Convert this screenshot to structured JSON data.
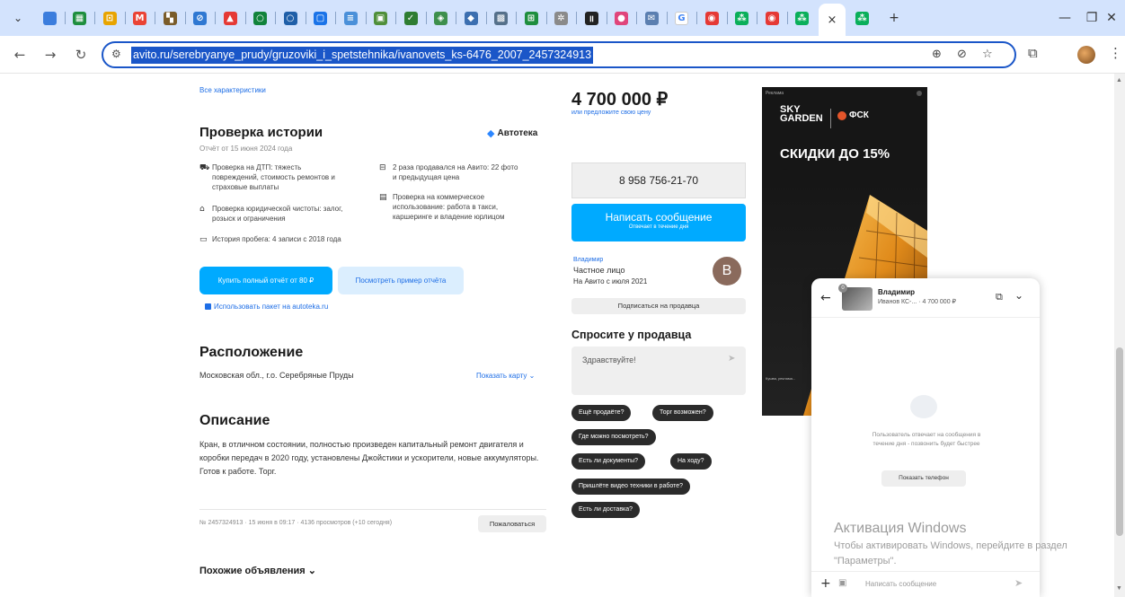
{
  "browser": {
    "tabs": [
      {
        "icon": "chrome-icon",
        "color": "#3b7ddd",
        "glyph": ""
      },
      {
        "icon": "sheets-icon",
        "color": "#1e8e3e",
        "glyph": "▦"
      },
      {
        "icon": "bookmark-icon",
        "color": "#e8a400",
        "glyph": "⊡"
      },
      {
        "icon": "gmail-icon",
        "color": "#ea4335",
        "glyph": "M"
      },
      {
        "icon": "app-icon",
        "color": "#7a5c2a",
        "glyph": "▚"
      },
      {
        "icon": "globe-icon",
        "color": "#2f78d2",
        "glyph": "⊘"
      },
      {
        "icon": "youtube-icon",
        "color": "#e53935",
        "glyph": "▲"
      },
      {
        "icon": "refresh-app-icon",
        "color": "#11833b",
        "glyph": "○"
      },
      {
        "icon": "circle-app-icon",
        "color": "#1f5fa8",
        "glyph": "○"
      },
      {
        "icon": "doc-icon",
        "color": "#1a73e8",
        "glyph": "▢"
      },
      {
        "icon": "list-icon",
        "color": "#4a90d9",
        "glyph": "≡"
      },
      {
        "icon": "image-icon",
        "color": "#4f8f3a",
        "glyph": "▣"
      },
      {
        "icon": "check-icon",
        "color": "#2e7d32",
        "glyph": "✓"
      },
      {
        "icon": "shield-icon",
        "color": "#3d8f4c",
        "glyph": "◈"
      },
      {
        "icon": "diamond-icon",
        "color": "#3c6fb0",
        "glyph": "◆"
      },
      {
        "icon": "photo-icon",
        "color": "#55708a",
        "glyph": "▩"
      },
      {
        "icon": "calc-icon",
        "color": "#1e8e3e",
        "glyph": "⊞"
      },
      {
        "icon": "star-app-icon",
        "color": "#8a8a8a",
        "glyph": "✲"
      },
      {
        "icon": "pause-icon",
        "color": "#222222",
        "glyph": "॥"
      },
      {
        "icon": "cam-icon",
        "color": "#e0457b",
        "glyph": "●"
      },
      {
        "icon": "mail-icon",
        "color": "#5b7fb0",
        "glyph": "✉"
      },
      {
        "icon": "google-icon",
        "color": "#ffffff",
        "glyph": "G"
      },
      {
        "icon": "avito-icon-1",
        "color": "#e53935",
        "glyph": "◉"
      },
      {
        "icon": "avito-icon-2",
        "color": "#0aaf5a",
        "glyph": "⁂"
      },
      {
        "icon": "avito-icon-3",
        "color": "#e53935",
        "glyph": "◉"
      },
      {
        "icon": "avito-icon-4",
        "color": "#0aaf5a",
        "glyph": "⁂"
      },
      {
        "icon": "close-tab-icon",
        "color": "#ffffff",
        "glyph": "×",
        "active": true
      },
      {
        "icon": "avito-icon-5",
        "color": "#0aaf5a",
        "glyph": "⁂"
      }
    ],
    "new_tab": "+",
    "url": "avito.ru/serebryanye_prudy/gruzoviki_i_spetstehnika/ivanovets_ks-6476_2007_2457324913"
  },
  "listing": {
    "all_specs_link": "Все характеристики",
    "history": {
      "title": "Проверка истории",
      "brand": "Автотека",
      "report_date": "Отчёт от 15 июня 2024 года",
      "features": [
        {
          "icon": "crash-icon",
          "text": "Проверка на ДТП: тяжесть повреждений, стоимость ремонтов и страховые выплаты"
        },
        {
          "icon": "bank-icon",
          "text": "Проверка юридической чистоты: залог, розыск и ограничения"
        },
        {
          "icon": "odometer-icon",
          "text": "История пробега: 4 записи с 2018 года"
        },
        {
          "icon": "sale-icon",
          "text": "2 раза продавался на Авито: 22 фото и предыдущая цена"
        },
        {
          "icon": "commercial-icon",
          "text": "Проверка на коммерческое использование: работа в такси, каршеринге и владение юрлицом"
        }
      ],
      "buy_button": "Купить полный отчёт от 80 ₽",
      "sample_button": "Посмотреть пример отчёта",
      "package_link": "Использовать пакет на autoteka.ru"
    },
    "location": {
      "title": "Расположение",
      "address": "Московская обл., г.о. Серебряные Пруды",
      "show_map": "Показать карту"
    },
    "description": {
      "title": "Описание",
      "text": "Кран, в отличном состоянии, полностью произведен капитальный ремонт двигателя и коробки передач в 2020 году, установлены Джойстики и ускорители, новые аккумуляторы. Готов к работе. Торг."
    },
    "meta": "№ 2457324913 · 15 июня в 09:17 · 4136 просмотров (+10 сегодня)",
    "complain_button": "Пожаловаться",
    "similar": "Похожие объявления"
  },
  "sidebar": {
    "price": "4 700 000 ₽",
    "offer_price": "или предложите свою цену",
    "phone": "8 958 756-21-70",
    "write_button": "Написать сообщение",
    "write_sub": "Отвечает в течение дня",
    "seller_name": "Владимир",
    "seller_type": "Частное лицо",
    "seller_since": "На Авито с июля 2021",
    "seller_initial": "В",
    "subscribe": "Подписаться на продавца",
    "ask_title": "Спросите у продавца",
    "ask_placeholder": "Здравствуйте!",
    "chips": [
      "Ещё продаёте?",
      "Торг возможен?",
      "Где можно посмотреть?",
      "Есть ли документы?",
      "На ходу?",
      "Пришлёте видео техники в работе?",
      "Есть ли доставка?"
    ]
  },
  "ad": {
    "label": "Реклама",
    "brand_left_1": "SKY",
    "brand_left_2": "GARDEN",
    "brand_right": "ФСК",
    "headline": "СКИДКИ ДО 15%",
    "fine_print": "Кушва, реклама... "
  },
  "chat": {
    "badge": "0",
    "name": "Владимир",
    "item": "Иванов КС-...",
    "price": "· 4 700 000 ₽",
    "empty_text": "Пользователь отвечает на сообщения в течение дня - позвонить будет быстрее",
    "show_phone": "Показать телефон",
    "input_placeholder": "Написать сообщение"
  },
  "windows": {
    "activation_title": "Активация Windows",
    "activation_text": "Чтобы активировать Windows, перейдите в раздел \"Параметры\"."
  },
  "colors": {
    "accent": "#00aaff",
    "link": "#1e6ee6",
    "chip": "#2b2b2b",
    "tabbar": "#d3e3fd"
  }
}
